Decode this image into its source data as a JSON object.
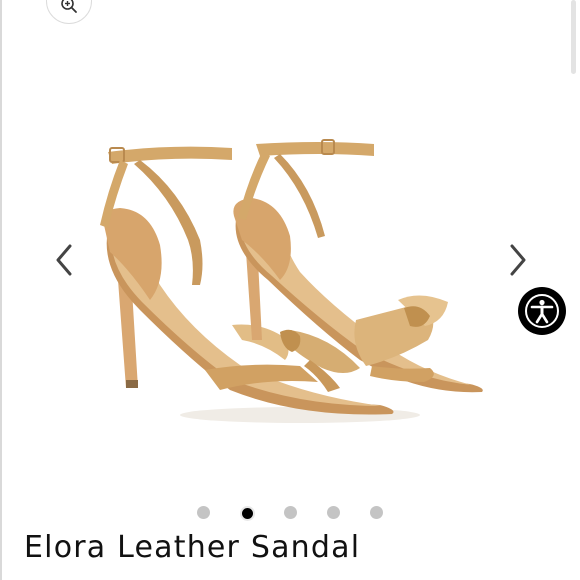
{
  "product": {
    "title": "Elora Leather Sandal",
    "image_alt": "Elora Leather Sandal product photo",
    "colors": {
      "leather": "#d4a86a",
      "leather_dark": "#b98a4f",
      "sole": "#e6c08a"
    }
  },
  "gallery": {
    "dot_count": 5,
    "active_index": 1,
    "prev_icon": "chevron-left-icon",
    "next_icon": "chevron-right-icon",
    "zoom_icon": "magnifier-zoom-icon"
  },
  "accessibility": {
    "icon": "accessibility-person-icon"
  }
}
